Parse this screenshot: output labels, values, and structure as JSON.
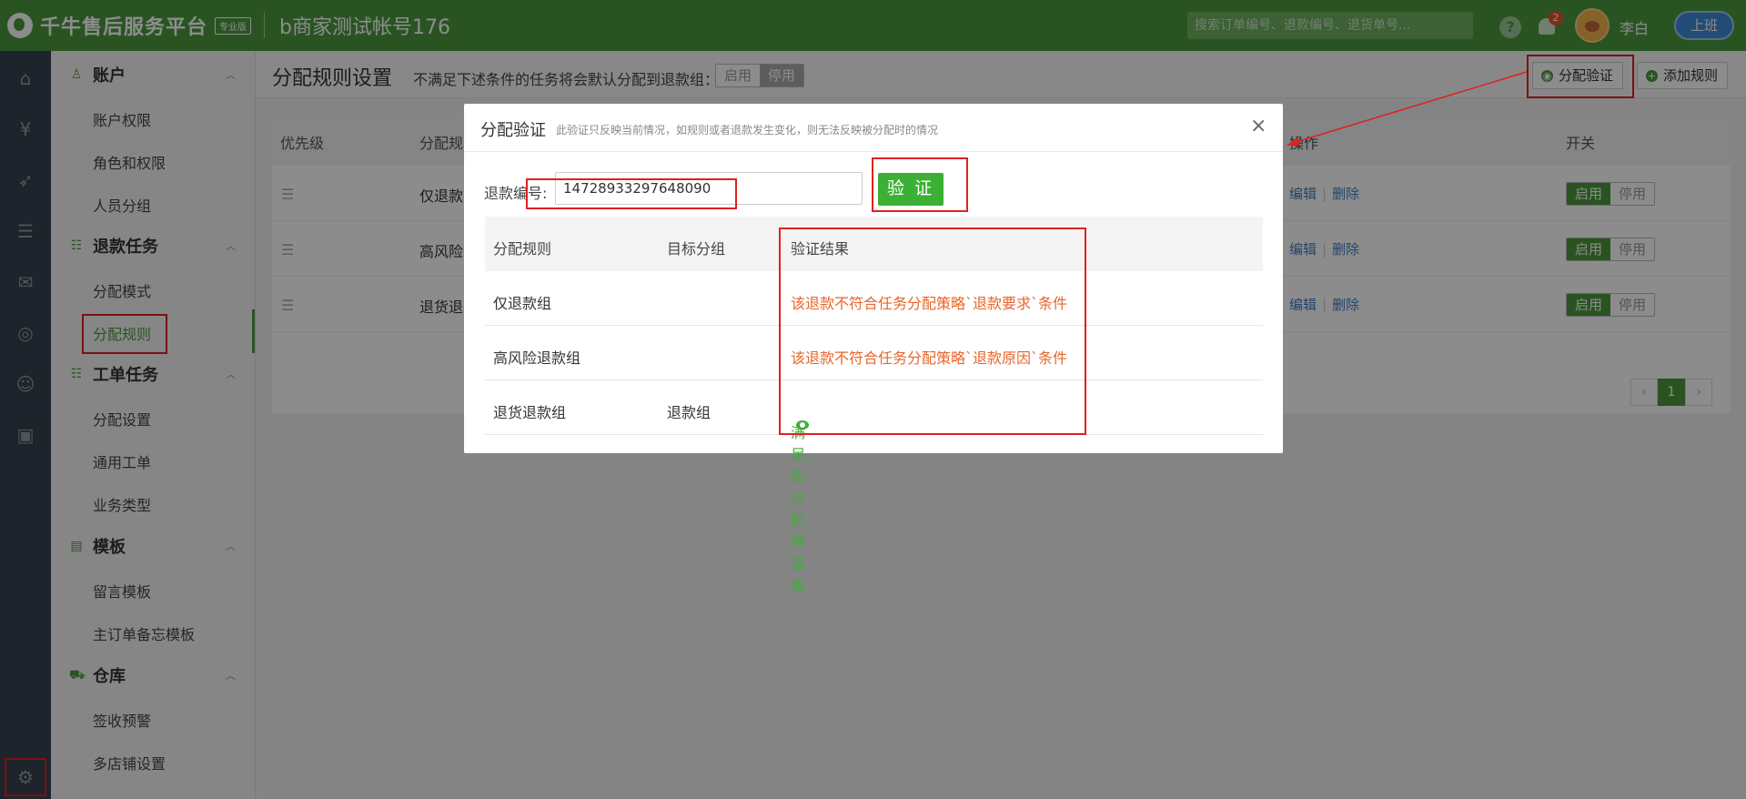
{
  "topbar": {
    "brand_title": "千牛售后服务平台",
    "edition": "专业版",
    "account": "b商家测试帐号176",
    "search_placeholder": "搜索订单编号、退款编号、退货单号...",
    "help": "?",
    "notification_count": "2",
    "username": "李白",
    "shift_button": "上班",
    "brand_color": "#4b9a3e"
  },
  "rail": {
    "icons": [
      "home-icon",
      "yen-icon",
      "rocket-icon",
      "list-icon",
      "message-icon",
      "compass-icon",
      "users-icon",
      "calendar-icon",
      "gear-icon"
    ]
  },
  "sidebar": {
    "groups": [
      {
        "label": "账户",
        "items": [
          "账户权限",
          "角色和权限",
          "人员分组"
        ]
      },
      {
        "label": "退款任务",
        "items": [
          "分配模式",
          "分配规则"
        ]
      },
      {
        "label": "工单任务",
        "items": [
          "分配设置",
          "通用工单",
          "业务类型"
        ]
      },
      {
        "label": "模板",
        "items": [
          "留言模板",
          "主订单备忘模板"
        ]
      },
      {
        "label": "仓库",
        "items": [
          "签收预警",
          "多店铺设置"
        ]
      }
    ],
    "active_item": "分配规则"
  },
  "page": {
    "title": "分配规则设置",
    "description": "不满足下述条件的任务将会默认分配到退款组：",
    "toggle_on": "启用",
    "toggle_off": "停用",
    "verify_button": "分配验证",
    "add_button": "添加规则"
  },
  "rule_list": {
    "columns": {
      "priority": "优先级",
      "rule": "分配规",
      "ops": "操作",
      "switch": "开关"
    },
    "rows": [
      {
        "name": "仅退款",
        "edit": "编辑",
        "delete": "删除",
        "on": "启用",
        "off": "停用"
      },
      {
        "name": "高风险",
        "edit": "编辑",
        "delete": "删除",
        "on": "启用",
        "off": "停用"
      },
      {
        "name": "退货退",
        "edit": "编辑",
        "delete": "删除",
        "on": "启用",
        "off": "停用"
      }
    ],
    "page": "1",
    "prev": "‹",
    "next": "›"
  },
  "modal": {
    "title": "分配验证",
    "subtitle": "此验证只反映当前情况，如规则或者退款发生变化，则无法反映被分配时的情况",
    "close": "×",
    "field_label": "退款编号:",
    "field_value": "14728933297648090",
    "verify_button": "验 证",
    "result_columns": {
      "rule": "分配规则",
      "group": "目标分组",
      "result": "验证结果"
    },
    "results": [
      {
        "rule": "仅退款组",
        "group": "",
        "result": "该退款不符合任务分配策略`退款要求`条件",
        "status": "fail"
      },
      {
        "rule": "高风险退款组",
        "group": "",
        "result": "该退款不符合任务分配策略`退款原因`条件",
        "status": "fail"
      },
      {
        "rule": "退货退款组",
        "group": "退款组",
        "result": "满足,应分配到该组",
        "status": "ok"
      }
    ],
    "fail_color": "#e8652a",
    "ok_color": "#3cb034"
  }
}
